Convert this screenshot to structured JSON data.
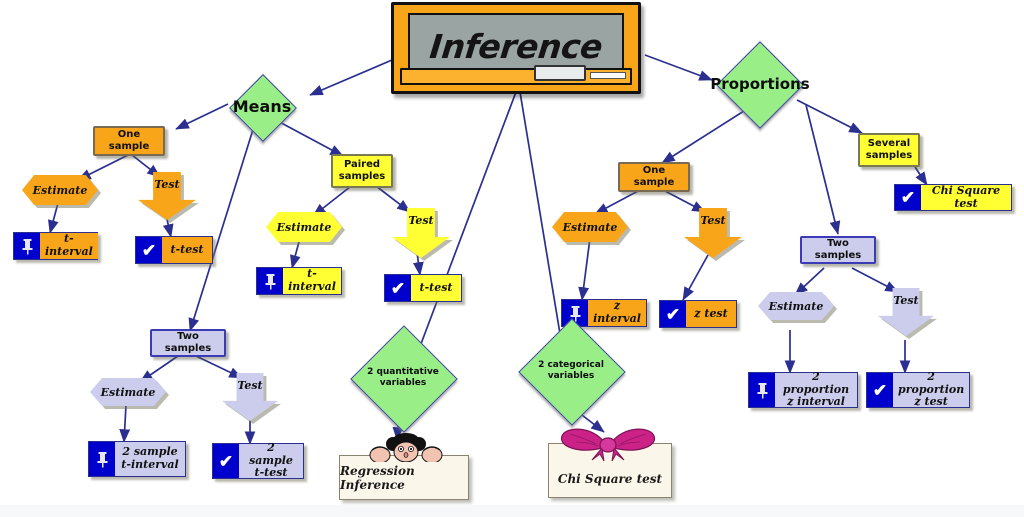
{
  "title": "Inference",
  "board": {
    "label": "Inference",
    "eraser": "eraser",
    "chalk": "chalk"
  },
  "branches": {
    "means": {
      "label": "Means"
    },
    "proportions": {
      "label": "Proportions"
    }
  },
  "nodes": {
    "means_one_sample": "One sample",
    "means_paired": "Paired\nsamples",
    "means_two_samples": "Two samples",
    "prop_one_sample": "One sample",
    "prop_several_samples": "Several\nsamples",
    "prop_two_samples": "Two samples",
    "quantitative": "2  quantitative\nvariables",
    "categorical": "2  categorical\nvariables"
  },
  "labels": {
    "estimate": "Estimate",
    "test": "Test"
  },
  "leaves": {
    "means_one_interval": "t-interval",
    "means_one_test": "t-test",
    "paired_interval": "t-interval",
    "paired_test": "t-test",
    "two_sample_interval": "2 sample\nt-interval",
    "two_sample_test": "2 sample\nt-test",
    "prop_one_interval": "z interval",
    "prop_one_test": "z test",
    "prop_two_interval": "2 proportion\nz interval",
    "prop_two_test": "2 proportion\nz test",
    "chi_square_several": "Chi Square test"
  },
  "cards": {
    "regression": "Regression Inference",
    "chi_square": "Chi Square test"
  },
  "icons": {
    "pushpin": "pushpin-icon",
    "check": "✔"
  },
  "colors": {
    "orange": "#f9a51a",
    "yellow": "#ffff33",
    "lavender": "#ccccec",
    "green": "#99ee88",
    "edge": "#2b2f8f",
    "icon_blue": "#0000cc",
    "board_frame": "#f9a51a",
    "board_face": "#9aa5a3",
    "card": "#faf6ea",
    "bow": "#cc2288"
  }
}
